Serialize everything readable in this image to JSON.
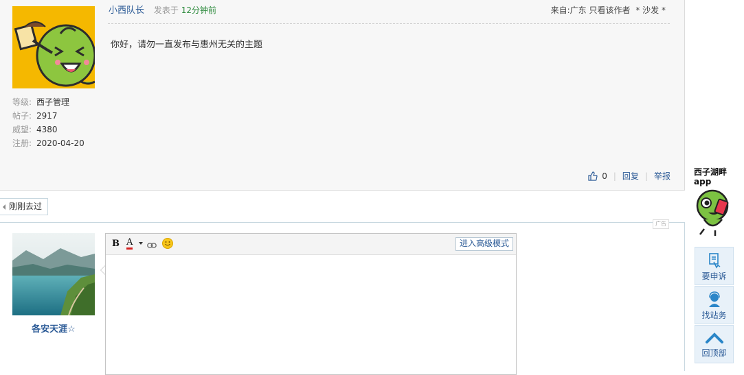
{
  "post": {
    "author": "小西队长",
    "posted_prefix": "发表于",
    "posted_time": "12分钟前",
    "location": "来自:广东",
    "view_author": "只看该作者",
    "floor": "* 沙发 *",
    "body": "你好，请勿一直发布与惠州无关的主题",
    "meta": [
      {
        "key": "等级:",
        "value": "西子管理"
      },
      {
        "key": "帖子:",
        "value": "2917"
      },
      {
        "key": "威望:",
        "value": "4380"
      },
      {
        "key": "注册:",
        "value": "2020-04-20"
      }
    ],
    "likes": "0",
    "reply_label": "回复",
    "report_label": "举报"
  },
  "recent_tab": "刚刚去过",
  "ad_label": "广告",
  "reply": {
    "username": "各安天涯☆",
    "advanced_mode": "进入高级模式",
    "toolbar_icons": [
      "bold-icon",
      "font-color-icon",
      "link-icon",
      "smiley-icon"
    ]
  },
  "sidebar": {
    "logo_line1": "西子湖畔",
    "logo_line2": "app",
    "buttons": [
      {
        "label": "要申诉",
        "icon": "appeal-icon"
      },
      {
        "label": "找站务",
        "icon": "support-icon"
      },
      {
        "label": "回顶部",
        "icon": "back-to-top-icon"
      }
    ]
  },
  "colors": {
    "link": "#2b5a96",
    "time_green": "#2e8b3e",
    "avatar_bg": "#f5b800",
    "sidebar_bg": "#e8f1f9"
  }
}
